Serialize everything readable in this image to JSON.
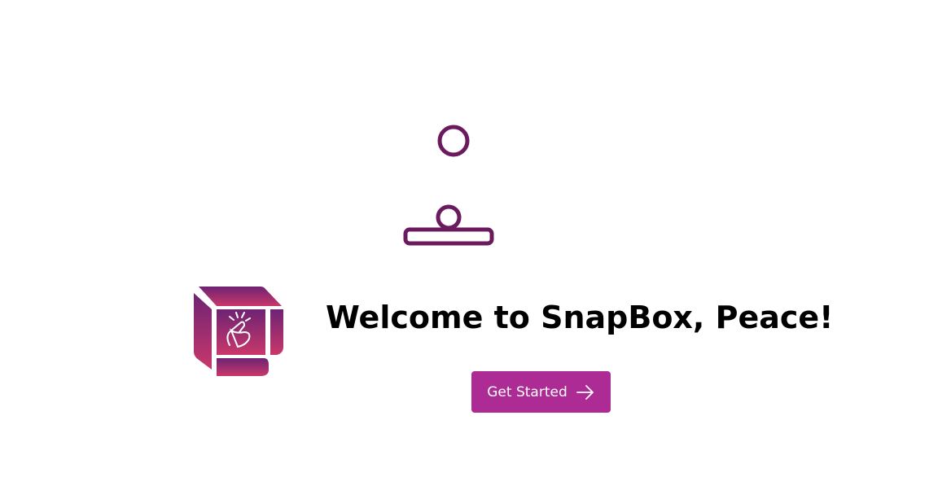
{
  "welcome": {
    "title": "Welcome to SnapBox, Peace!"
  },
  "actions": {
    "get_started_label": "Get Started"
  },
  "colors": {
    "accent": "#ac2b94",
    "illustration_stroke": "#6b1a5d",
    "logo_gradient_top": "#6e2374",
    "logo_gradient_bottom": "#c9386a"
  },
  "icons": {
    "illustration": "person-at-desk-icon",
    "logo": "snapbox-logo",
    "button_arrow": "arrow-right-icon"
  }
}
